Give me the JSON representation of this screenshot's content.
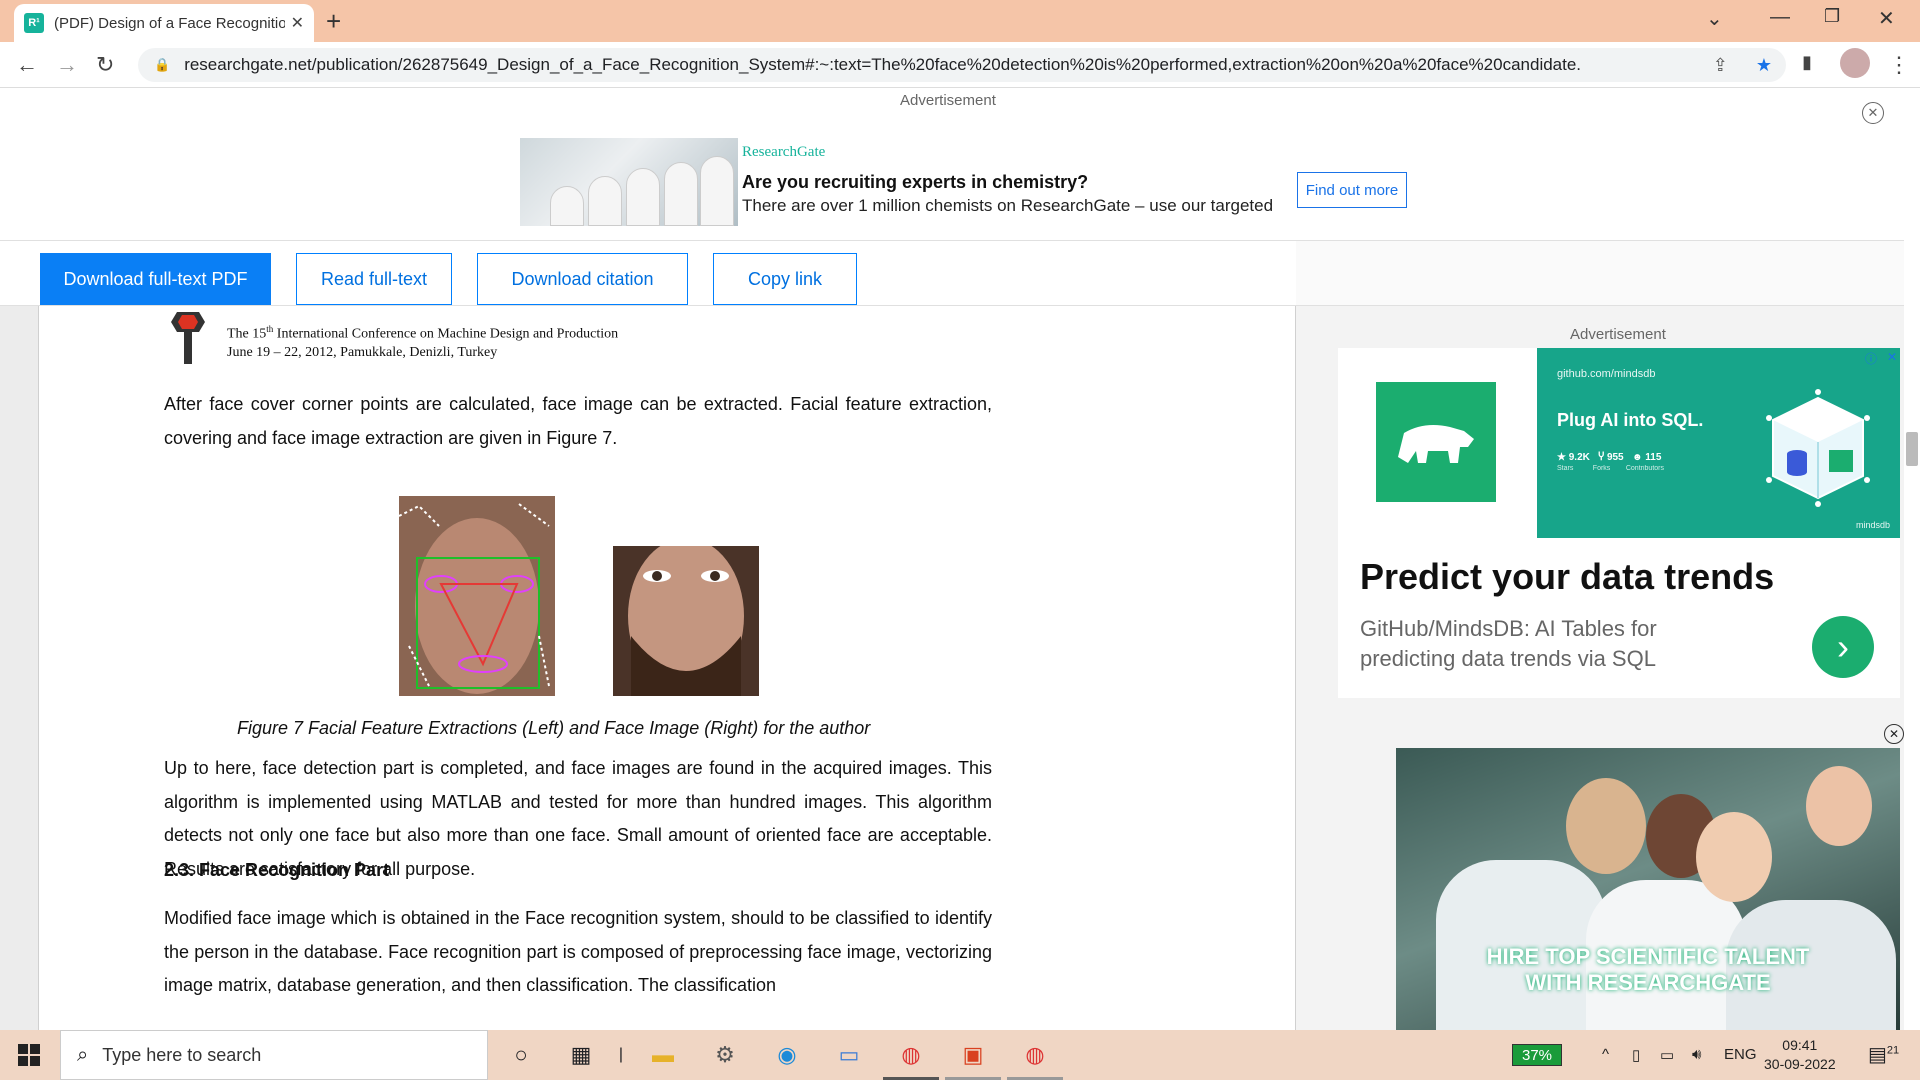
{
  "browser": {
    "tab_title": "(PDF) Design of a Face Recognition System",
    "favicon_text": "R¹",
    "url": "researchgate.net/publication/262875649_Design_of_a_Face_Recognition_System#:~:text=The%20face%20detection%20is%20performed,extraction%20on%20a%20face%20candidate."
  },
  "top_ad": {
    "label": "Advertisement",
    "brand": "ResearchGate",
    "headline": "Are you recruiting experts in chemistry?",
    "body": "There are over 1 million chemists on ResearchGate – use our targeted",
    "button": "Find out more"
  },
  "actions": {
    "download_pdf": "Download full-text PDF",
    "read_full": "Read full-text",
    "download_citation": "Download citation",
    "copy_link": "Copy link"
  },
  "document": {
    "conf_line1_pre": "The 15",
    "conf_line1_sup": "th",
    "conf_line1_post": " International Conference on Machine Design and Production",
    "conf_line2": "June 19 – 22, 2012, Pamukkale, Denizli, Turkey",
    "para1": "After face cover corner points are calculated, face image can be extracted. Facial feature extraction, covering and face image extraction are given in Figure 7.",
    "caption": "Figure 7 Facial Feature Extractions (Left) and Face Image (Right) for the author",
    "para2": "Up to here, face detection part is completed, and face images are found in the acquired images. This algorithm is implemented using MATLAB and tested for more than hundred images. This algorithm detects not only one face but also more than one face. Small amount of oriented face are acceptable. Results are satisfactory for all purpose.",
    "heading": "2.3. Face Recognition Part",
    "para3": "Modified face image which is obtained in the Face recognition system, should to be classified to identify the person in the database. Face recognition part is composed of preprocessing face image, vectorizing image matrix, database generation, and then classification. The classification"
  },
  "side_ad": {
    "label": "Advertisement",
    "site": "github.com/mindsdb",
    "title": "Plug AI into SQL.",
    "stat_stars": "9.2K",
    "stat_forks": "955",
    "stat_contrib": "115",
    "stat_stars_label": "Stars",
    "stat_forks_label": "Forks",
    "stat_contrib_label": "Contributors",
    "brand": "mindsdb",
    "headline": "Predict your data trends",
    "subline": "GitHub/MindsDB: AI Tables for predicting data trends via SQL"
  },
  "video_ad": {
    "line1": "HIRE TOP SCIENTIFIC TALENT",
    "line2": "WITH RESEARCHGATE"
  },
  "taskbar": {
    "search_placeholder": "Type here to search",
    "battery": "37%",
    "lang": "ENG",
    "time": "09:41",
    "date": "30-09-2022",
    "notifications": "21"
  }
}
